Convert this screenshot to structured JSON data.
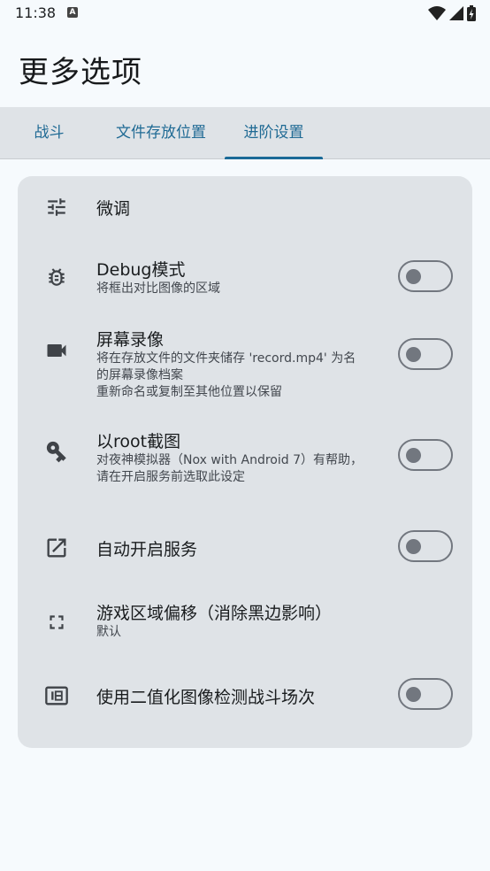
{
  "status": {
    "time": "11:38",
    "notif_letter": "A"
  },
  "header": {
    "title": "更多选项"
  },
  "tabs": [
    {
      "label": "战斗"
    },
    {
      "label": "文件存放位置"
    },
    {
      "label": "进阶设置"
    }
  ],
  "settings": [
    {
      "title": "微调",
      "subtitle": "",
      "icon": "tune-icon"
    },
    {
      "title": "Debug模式",
      "subtitle": "将框出对比图像的区域",
      "icon": "bug-icon",
      "toggle": false
    },
    {
      "title": "屏幕录像",
      "subtitle": "将在存放文件的文件夹储存 'record.mp4' 为名\n的屏幕录像档案\n重新命名或复制至其他位置以保留",
      "icon": "videocam-icon",
      "toggle": false
    },
    {
      "title": "以root截图",
      "subtitle": "对夜神模拟器（Nox with Android 7）有帮助，\n请在开启服务前选取此设定",
      "icon": "key-icon",
      "toggle": false
    },
    {
      "title": "自动开启服务",
      "subtitle": "",
      "icon": "open-in-new-icon",
      "toggle": false
    },
    {
      "title": "游戏区域偏移（消除黑边影响）",
      "subtitle": "默认",
      "icon": "fullscreen-icon"
    },
    {
      "title": "使用二值化图像检测战斗场次",
      "subtitle": "",
      "icon": "binary-icon",
      "toggle": false
    }
  ],
  "colors": {
    "accent": "#1a6a97",
    "background": "#f6fafd",
    "surface": "#dfe3e7"
  }
}
